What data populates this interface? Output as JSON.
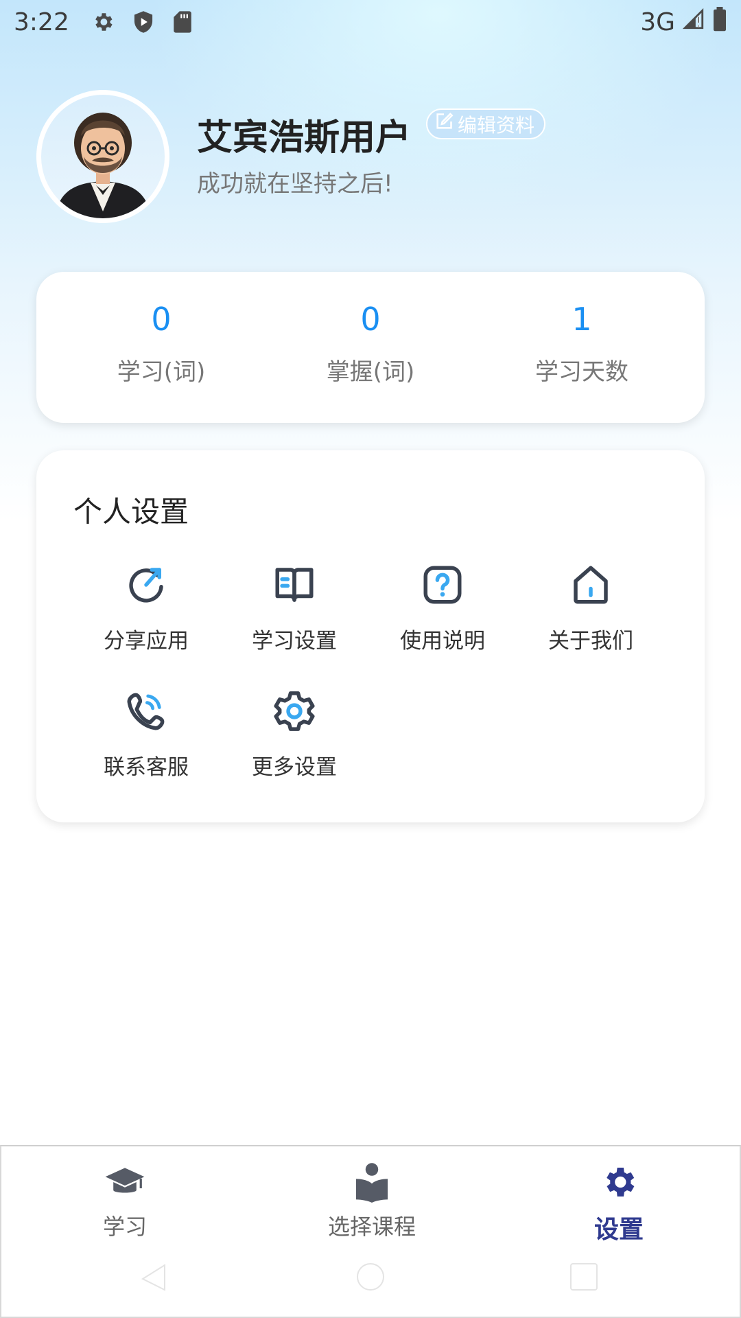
{
  "status_bar": {
    "time": "3:22",
    "network": "3G",
    "left_icons": [
      "gear-icon",
      "shield-icon",
      "sd-card-icon"
    ],
    "right_icons": [
      "signal-icon",
      "battery-icon"
    ]
  },
  "profile": {
    "username": "艾宾浩斯用户",
    "edit_label": "编辑资料",
    "motto": "成功就在坚持之后!"
  },
  "stats": [
    {
      "value": "0",
      "label": "学习(词)"
    },
    {
      "value": "0",
      "label": "掌握(词)"
    },
    {
      "value": "1",
      "label": "学习天数"
    }
  ],
  "settings": {
    "title": "个人设置",
    "items": [
      {
        "label": "分享应用",
        "icon": "share-refresh-icon"
      },
      {
        "label": "学习设置",
        "icon": "book-icon"
      },
      {
        "label": "使用说明",
        "icon": "help-icon"
      },
      {
        "label": "关于我们",
        "icon": "home-icon"
      },
      {
        "label": "联系客服",
        "icon": "phone-icon"
      },
      {
        "label": "更多设置",
        "icon": "settings-gear-icon"
      }
    ]
  },
  "bottom_nav": {
    "items": [
      {
        "label": "学习",
        "icon": "graduation-cap-icon",
        "active": false
      },
      {
        "label": "选择课程",
        "icon": "reading-icon",
        "active": false
      },
      {
        "label": "设置",
        "icon": "gear-icon",
        "active": true
      }
    ]
  },
  "colors": {
    "accent_blue": "#1a8ff2",
    "nav_active": "#2f3a8f",
    "icon_dark": "#3a4250",
    "icon_accent": "#3aa8f0"
  }
}
